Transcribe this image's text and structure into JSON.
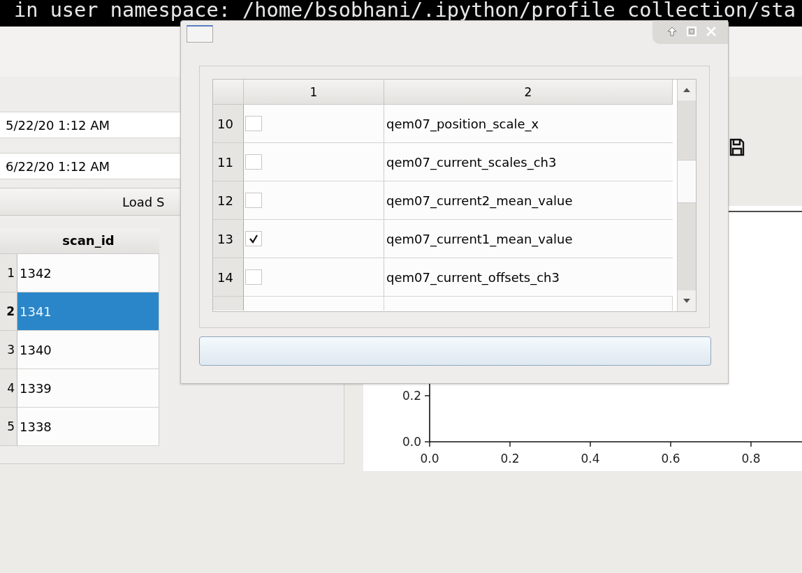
{
  "terminal": {
    "text": "in user namespace: /home/bsobhani/.ipython/profile_collection/sta"
  },
  "filters": {
    "start_date": "5/22/20 1:12 AM",
    "end_date": "6/22/20 1:12 AM",
    "load_button": "Load S"
  },
  "scans_table": {
    "columns": [
      "scan_id"
    ],
    "rows": [
      {
        "index": "1",
        "scan_id": "1342",
        "selected": false
      },
      {
        "index": "2",
        "scan_id": "1341",
        "selected": true
      },
      {
        "index": "3",
        "scan_id": "1340",
        "selected": false
      },
      {
        "index": "4",
        "scan_id": "1339",
        "selected": false
      },
      {
        "index": "5",
        "scan_id": "1338",
        "selected": false
      }
    ]
  },
  "plot": {
    "chart_data": {
      "type": "line",
      "xlim": [
        0,
        1
      ],
      "ylim": [
        0,
        1
      ],
      "xticks": [
        {
          "value": 0,
          "label": "0.0"
        },
        {
          "value": 0.2,
          "label": "0.2"
        },
        {
          "value": 0.4,
          "label": "0.4"
        },
        {
          "value": 0.6,
          "label": "0.6"
        },
        {
          "value": 0.8,
          "label": "0.8"
        }
      ],
      "yticks": [
        {
          "value": 0,
          "label": "0.0"
        },
        {
          "value": 0.2,
          "label": "0.2"
        }
      ]
    }
  },
  "dialog": {
    "table": {
      "columns": [
        "1",
        "2"
      ],
      "rows": [
        {
          "index": "10",
          "checked": false,
          "name": "qem07_position_scale_x"
        },
        {
          "index": "11",
          "checked": false,
          "name": "qem07_current_scales_ch3"
        },
        {
          "index": "12",
          "checked": false,
          "name": "qem07_current2_mean_value"
        },
        {
          "index": "13",
          "checked": true,
          "name": "qem07_current1_mean_value"
        },
        {
          "index": "14",
          "checked": false,
          "name": "qem07_current_offsets_ch3"
        }
      ]
    }
  }
}
